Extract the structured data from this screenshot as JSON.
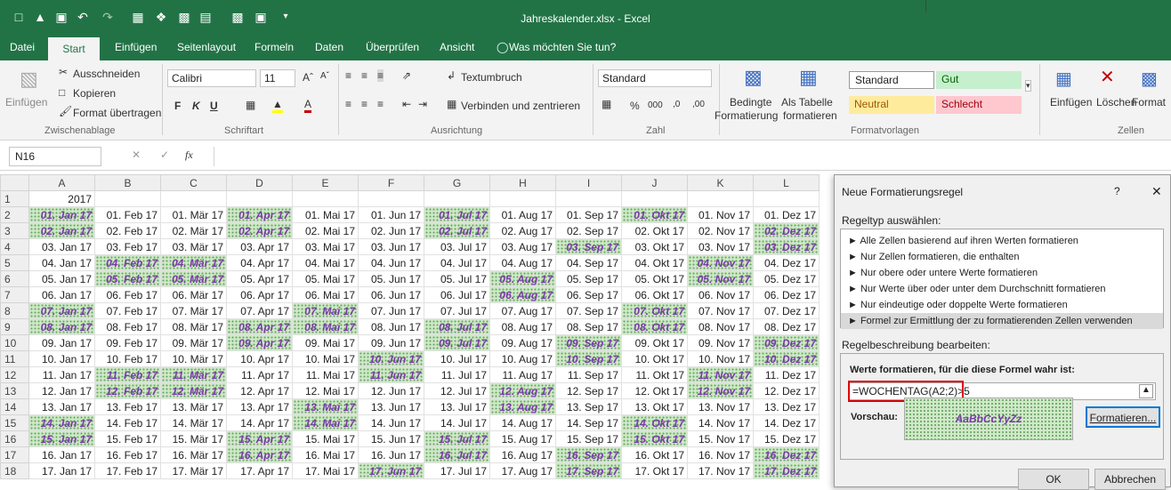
{
  "qat_icons": [
    "new-file-icon",
    "open-icon",
    "save-icon",
    "undo-icon",
    "redo-icon",
    "print-preview-icon",
    "share-icon",
    "print-icon",
    "screenshot-icon",
    "chart-icon",
    "preview-icon",
    "customize-icon"
  ],
  "window_title": "Jahreskalender.xlsx - Excel",
  "tabs": [
    "Datei",
    "Start",
    "Einfügen",
    "Seitenlayout",
    "Formeln",
    "Daten",
    "Überprüfen",
    "Ansicht",
    "Was möchten Sie tun?"
  ],
  "ribbon": {
    "clipboard": {
      "paste": "Einfügen",
      "cut": "Ausschneiden",
      "copy": "Kopieren",
      "format_painter": "Format übertragen",
      "group": "Zwischenablage"
    },
    "font": {
      "name": "Calibri",
      "size": "11",
      "bold": "F",
      "italic": "K",
      "underline": "U",
      "group": "Schriftart"
    },
    "alignment": {
      "wrap": "Textumbruch",
      "merge": "Verbinden und zentrieren",
      "group": "Ausrichtung"
    },
    "number": {
      "format": "Standard",
      "percent": "%",
      "thousands": "000",
      "inc": ",0",
      "dec": ",00",
      "group": "Zahl"
    },
    "styles": {
      "cond_line1": "Bedingte",
      "cond_line2": "Formatierung",
      "table_line1": "Als Tabelle",
      "table_line2": "formatieren",
      "standard": "Standard",
      "gut": "Gut",
      "neutral": "Neutral",
      "schlecht": "Schlecht",
      "group": "Formatvorlagen"
    },
    "cells": {
      "insert": "Einfügen",
      "delete": "Löschen",
      "format": "Format",
      "group": "Zellen"
    }
  },
  "formula_bar": {
    "name_box": "N16",
    "fx": "fx",
    "value": ""
  },
  "columns": [
    "A",
    "B",
    "C",
    "D",
    "E",
    "F",
    "G",
    "H",
    "I",
    "J",
    "K",
    "L"
  ],
  "row_numbers": [
    "1",
    "2",
    "3",
    "4",
    "5",
    "6",
    "7",
    "8",
    "9",
    "10",
    "11",
    "12",
    "13",
    "14",
    "15",
    "16",
    "17",
    "18"
  ],
  "year": "2017",
  "months": [
    "Jan",
    "Feb",
    "Mär",
    "Apr",
    "Mai",
    "Jun",
    "Jul",
    "Aug",
    "Sep",
    "Okt",
    "Nov",
    "Dez"
  ],
  "highlighted": [
    [
      0,
      3,
      6,
      9
    ],
    [
      0,
      3,
      6,
      11
    ],
    [
      8,
      11
    ],
    [
      1,
      2,
      10
    ],
    [
      1,
      2,
      7,
      10
    ],
    [
      7
    ],
    [
      0,
      4,
      9
    ],
    [
      0,
      4,
      3,
      6,
      9
    ],
    [
      3,
      6,
      8,
      11
    ],
    [
      5,
      8,
      11
    ],
    [
      1,
      2,
      5,
      10
    ],
    [
      1,
      2,
      7,
      10
    ],
    [
      4,
      7
    ],
    [
      0,
      4,
      9
    ],
    [
      0,
      3,
      6,
      9
    ],
    [
      3,
      6,
      8,
      11
    ],
    [
      5,
      8,
      11
    ]
  ],
  "dialog": {
    "title": "Neue Formatierungsregel",
    "help": "?",
    "close": "✕",
    "rule_type_label": "Regeltyp auswählen:",
    "rule_types": [
      "► Alle Zellen basierend auf ihren Werten formatieren",
      "► Nur Zellen formatieren, die enthalten",
      "► Nur obere oder untere Werte formatieren",
      "► Nur Werte über oder unter dem Durchschnitt formatieren",
      "► Nur eindeutige oder doppelte Werte formatieren",
      "► Formel zur Ermittlung der zu formatierenden Zellen verwenden"
    ],
    "desc_label": "Regelbeschreibung bearbeiten:",
    "formula_label": "Werte formatieren, für die diese Formel wahr ist:",
    "formula": "=WOCHENTAG(A2;2)>5",
    "preview_label": "Vorschau:",
    "preview_text": "AaBbCcYyZz",
    "format_button": "Formatieren...",
    "ok": "OK",
    "cancel": "Abbrechen"
  }
}
